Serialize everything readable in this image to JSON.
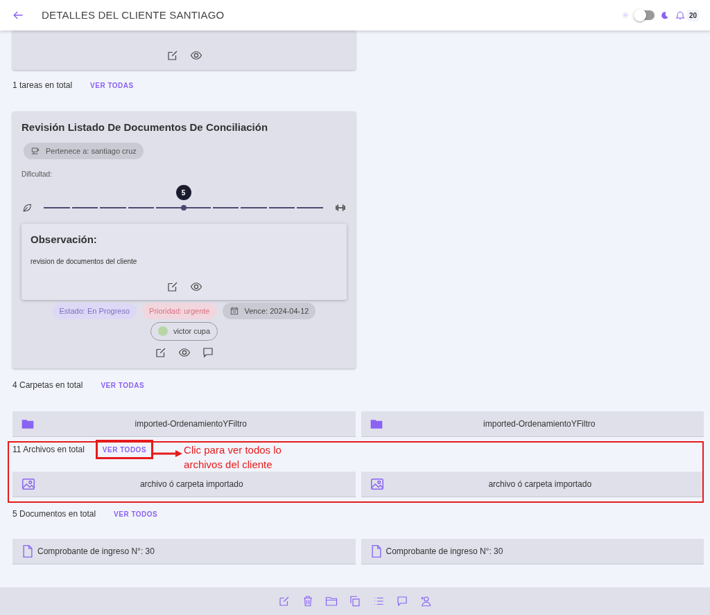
{
  "header": {
    "title": "DETALLES DEL CLIENTE SANTIAGO",
    "dark_mode": false,
    "notifications": "20"
  },
  "tasks": {
    "count": "1 tareas en total",
    "link": "VER TODAS"
  },
  "task": {
    "title": "Revisión Listado De Documentos De Conciliación",
    "owner": "Pertenece a: santiago cruz",
    "difficulty_label": "Dificultad:",
    "difficulty": {
      "level": 0.5,
      "value": "5"
    },
    "observation": {
      "title": "Observación:",
      "text": "revision de documentos del cliente"
    },
    "tags": [
      {
        "kind": "status",
        "text": "Estado: En Progreso"
      },
      {
        "kind": "priority",
        "text": "Prioridad: urgente"
      },
      {
        "kind": "due",
        "text": "Vence: 2024-04-12"
      }
    ],
    "assignee": "victor cupa"
  },
  "folders": {
    "count": "4 Carpetas en total",
    "link": "VER TODAS",
    "items": [
      "imported-OrdenamientoYFiltro",
      "imported-OrdenamientoYFiltro"
    ]
  },
  "files": {
    "count": "11 Archivos en total",
    "link": "VER TODOS",
    "items": [
      "archivo ó carpeta importado",
      "archivo ó carpeta importado"
    ]
  },
  "documents": {
    "count": "5 Documentos en total",
    "link": "VER TODOS",
    "items": [
      "Comprobante de ingreso N°: 30",
      "Comprobante de ingreso N°: 30"
    ]
  },
  "annotation": {
    "text": "Clic para ver todos lo archivos del cliente"
  }
}
